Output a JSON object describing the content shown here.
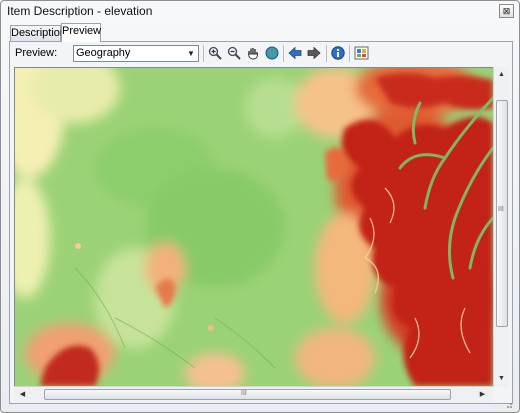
{
  "window": {
    "title": "Item Description - elevation",
    "close_glyph": "⊠"
  },
  "tabs": [
    {
      "label": "Description",
      "active": false
    },
    {
      "label": "Preview",
      "active": true
    }
  ],
  "toolbar": {
    "preview_label": "Preview:",
    "preview_value": "Geography",
    "tools": [
      "zoom-in-icon",
      "zoom-out-icon",
      "pan-hand-icon",
      "full-extent-globe-icon",
      "back-arrow-icon",
      "forward-arrow-icon",
      "identify-info-icon",
      "create-thumbnail-icon"
    ]
  },
  "scrollbars": {
    "grip": "III"
  },
  "map_colors": {
    "low": "#fbf4b8",
    "mid": "#8fd06a",
    "high": "#b5121b"
  }
}
